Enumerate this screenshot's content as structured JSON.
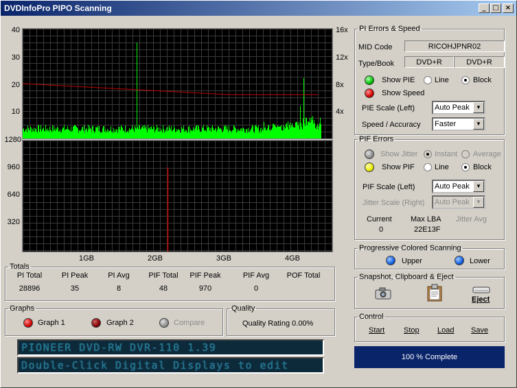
{
  "window": {
    "title": "DVDInfoPro PIPO Scanning",
    "min": "_",
    "max": "□",
    "close": "×"
  },
  "graph_top": {
    "y_left": [
      "40",
      "30",
      "20",
      "10"
    ],
    "y_right": [
      "16x",
      "12x",
      "8x",
      "4x"
    ]
  },
  "graph_bottom": {
    "y_left": [
      "1280",
      "960",
      "640",
      "320"
    ],
    "x_labels": [
      "1GB",
      "2GB",
      "3GB",
      "4GB"
    ]
  },
  "chart_data": [
    {
      "type": "area",
      "series": [
        {
          "name": "PIE",
          "peak": 35,
          "baseline": 2
        },
        {
          "name": "Speed",
          "start": 20,
          "end": 16
        }
      ],
      "y_left_range": [
        0,
        40
      ],
      "y_right_range": [
        0,
        16
      ],
      "x_labels": [
        "1GB",
        "2GB",
        "3GB",
        "4GB"
      ]
    },
    {
      "type": "bar",
      "series": [
        {
          "name": "PIF",
          "peak": 970
        }
      ],
      "y_range": [
        0,
        1280
      ],
      "x_labels": [
        "1GB",
        "2GB",
        "3GB",
        "4GB"
      ]
    }
  ],
  "totals": {
    "legend": "Totals",
    "headers": [
      "PI Total",
      "PI Peak",
      "PI Avg",
      "PIF Total",
      "PIF Peak",
      "PIF Avg",
      "POF Total"
    ],
    "values": [
      "28896",
      "35",
      "8",
      "48",
      "970",
      "0",
      ""
    ]
  },
  "graphs": {
    "legend": "Graphs",
    "graph1": "Graph 1",
    "graph2": "Graph 2",
    "compare": "Compare"
  },
  "quality": {
    "legend": "Quality",
    "rating": "Quality Rating 0.00%"
  },
  "lcd": {
    "line1": "PIONEER DVD-RW  DVR-110 1.39",
    "line2": "Double-Click Digital Displays to edit"
  },
  "pi": {
    "legend": "PI Errors & Speed",
    "mid_label": "MID Code",
    "mid_value": "RICOHJPNR02",
    "type_label": "Type/Book",
    "type_value": "DVD+R",
    "book_value": "DVD+R",
    "show_pie": "Show PIE",
    "line": "Line",
    "block": "Block",
    "show_speed": "Show Speed",
    "pie_scale_label": "PIE Scale (Left)",
    "pie_scale_value": "Auto Peak",
    "speed_label": "Speed / Accuracy",
    "speed_value": "Faster"
  },
  "pif": {
    "legend": "PIF Errors",
    "show_jitter": "Show Jitter",
    "instant": "Instant",
    "average": "Average",
    "show_pif": "Show PIF",
    "line": "Line",
    "block": "Block",
    "pif_scale_label": "PIF Scale (Left)",
    "pif_scale_value": "Auto Peak",
    "jitter_scale_label": "Jitter Scale (Right)",
    "jitter_scale_value": "Auto Peak",
    "current_label": "Current",
    "current_value": "0",
    "maxlba_label": "Max LBA",
    "maxlba_value": "22E13F",
    "jitter_avg_label": "Jitter Avg"
  },
  "progressive": {
    "legend": "Progressive Colored Scanning",
    "upper": "Upper",
    "lower": "Lower"
  },
  "snapshot": {
    "legend": "Snapshot,  Clipboard  & Eject",
    "eject": "Eject"
  },
  "control": {
    "legend": "Control",
    "start": "Start",
    "stop": "Stop",
    "load": "Load",
    "save": "Save"
  },
  "progress": {
    "label": "100 % Complete",
    "value": 1.0
  },
  "colors": {
    "pie": "#00ff00",
    "speed": "#c00000",
    "pif": "#c00000",
    "grid": "#3a3a3a",
    "panel": "#d4d0c8"
  }
}
